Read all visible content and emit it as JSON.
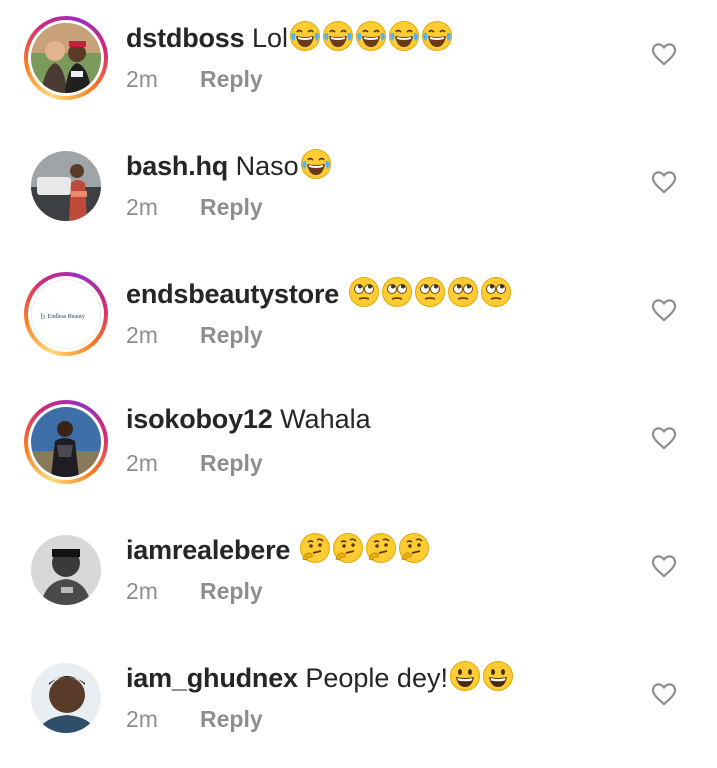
{
  "comments": [
    {
      "username": "dstdboss",
      "text": "Lol",
      "emojis": [
        "laugh-cry",
        "laugh-cry",
        "laugh-cry",
        "laugh-cry",
        "laugh-cry"
      ],
      "time": "2m",
      "reply": "Reply",
      "ring": true
    },
    {
      "username": "bash.hq",
      "text": "Naso",
      "emojis": [
        "laugh-cry"
      ],
      "time": "2m",
      "reply": "Reply",
      "ring": false
    },
    {
      "username": "endsbeautystore",
      "text": "",
      "emojis": [
        "eye-roll",
        "eye-roll",
        "eye-roll",
        "eye-roll",
        "eye-roll"
      ],
      "time": "2m",
      "reply": "Reply",
      "ring": true,
      "avatar_text": "Endless Beauty"
    },
    {
      "username": "isokoboy12",
      "text": "Wahala",
      "emojis": [],
      "time": "2m",
      "reply": "Reply",
      "ring": true
    },
    {
      "username": "iamrealebere",
      "text": "",
      "emojis": [
        "thinking",
        "thinking",
        "thinking",
        "thinking"
      ],
      "time": "2m",
      "reply": "Reply",
      "ring": false
    },
    {
      "username": "iam_ghudnex",
      "text": "People dey!",
      "emojis": [
        "grin",
        "grin"
      ],
      "time": "2m",
      "reply": "Reply",
      "ring": false
    }
  ],
  "colors": {
    "text": "#262626",
    "muted": "#8e8e8e",
    "ring": [
      "#feda75",
      "#fa7e1e",
      "#d62976",
      "#962fbf"
    ]
  }
}
